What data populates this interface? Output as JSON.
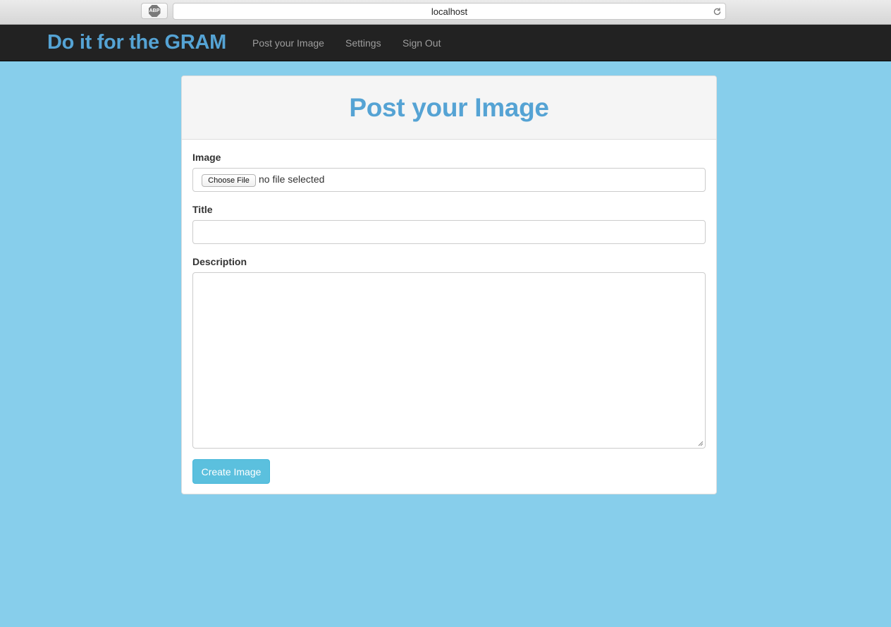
{
  "browser": {
    "adblock_label": "ABP",
    "url": "localhost"
  },
  "navbar": {
    "brand": "Do it for the GRAM",
    "links": [
      "Post your Image",
      "Settings",
      "Sign Out"
    ]
  },
  "form": {
    "title": "Post your Image",
    "image_label": "Image",
    "file_button": "Choose File",
    "file_status": "no file selected",
    "title_label": "Title",
    "title_value": "",
    "description_label": "Description",
    "description_value": "",
    "submit_label": "Create Image"
  },
  "colors": {
    "page_background": "#87ceeb",
    "navbar_background": "#222222",
    "brand": "#55a3d4",
    "submit_button": "#5bc0de"
  },
  "icons": {
    "adblock": "adblock-icon",
    "reload": "reload-icon"
  }
}
